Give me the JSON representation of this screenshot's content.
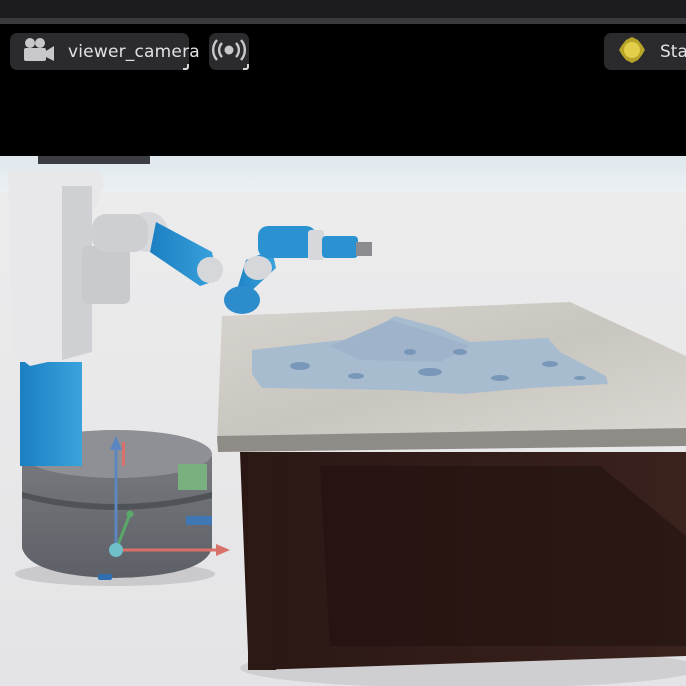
{
  "toolbar": {
    "camera_selector": {
      "icon": "video-camera-icon",
      "label": "viewer_camera"
    },
    "stream_button": {
      "icon": "broadcast-icon"
    },
    "stage_lighting": {
      "icon": "sun-icon",
      "label": "Stage"
    }
  },
  "viewport": {
    "scene": "mobile manipulator robot beside a table with a folded cloth",
    "gizmo_axes": {
      "x_color": "#d9706a",
      "y_color": "#5aa86a",
      "z_color": "#5b86c2",
      "origin_color": "#6fc0c8"
    }
  }
}
